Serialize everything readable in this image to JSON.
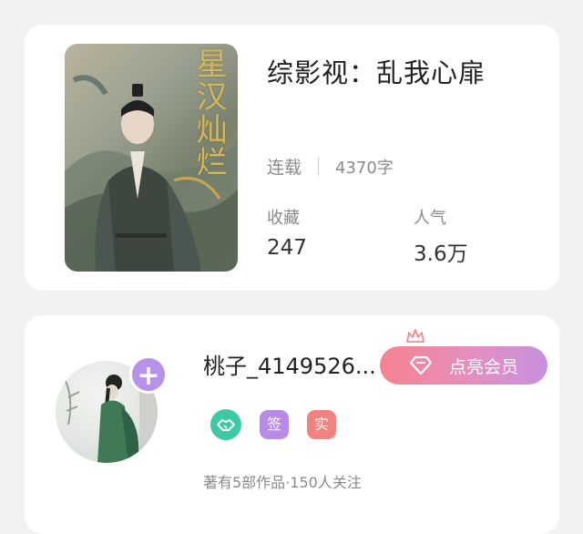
{
  "book": {
    "cover_text": "星汉灿烂",
    "title": "综影视：乱我心扉",
    "status": "连载",
    "word_count": "4370字",
    "stats": [
      {
        "label": "收藏",
        "value": "247"
      },
      {
        "label": "人气",
        "value": "3.6万"
      }
    ]
  },
  "author": {
    "name": "桃子_4149526...",
    "follow_symbol": "+",
    "vip_label": "点亮会员",
    "badges": {
      "sign": "签",
      "real": "实"
    },
    "stats_text": "著有5部作品·150人关注"
  },
  "icons": [
    "plus-icon",
    "crown-icon",
    "diamond-icon",
    "handshake-icon"
  ],
  "colors": {
    "vip_start": "#f5838f",
    "vip_end": "#c78fe0",
    "plus": "#b892e8",
    "badge_green": "#3cc9a4",
    "badge_purple": "#b98ae6",
    "badge_red": "#f0837f"
  }
}
